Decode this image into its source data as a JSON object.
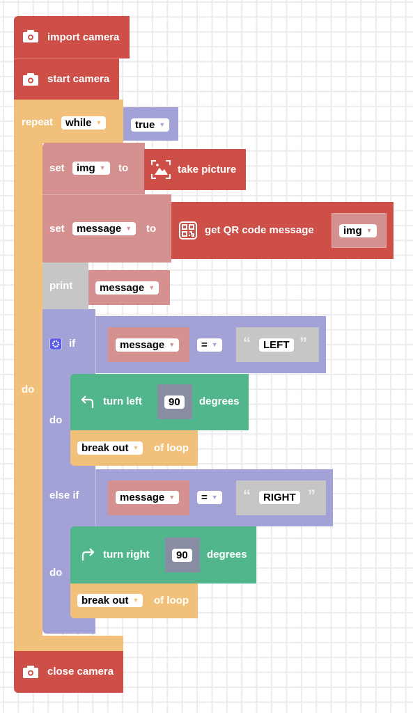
{
  "workspace": {
    "blocks": {
      "import_camera": {
        "label": "import camera",
        "icon": "camera-icon"
      },
      "start_camera": {
        "label": "start camera",
        "icon": "camera-icon"
      },
      "repeat": {
        "label": "repeat",
        "mode": "while",
        "do_label": "do",
        "condition": "true"
      },
      "set_img": {
        "set_label": "set",
        "variable": "img",
        "to_label": "to",
        "value_label": "take picture",
        "value_icon": "image-capture-icon"
      },
      "set_message": {
        "set_label": "set",
        "variable": "message",
        "to_label": "to",
        "value_label": "get QR code message",
        "value_icon": "qr-code-icon",
        "arg": "img"
      },
      "print": {
        "label": "print",
        "arg": "message"
      },
      "if_block": {
        "if_label": "if",
        "else_if_label": "else if",
        "do_label": "do",
        "branches": [
          {
            "variable": "message",
            "operator": "=",
            "text_value": "LEFT",
            "turn_label": "turn left",
            "degrees_value": "90",
            "degrees_label": "degrees",
            "turn_icon": "turn-left-icon",
            "break_value": "break out",
            "break_suffix": "of loop"
          },
          {
            "variable": "message",
            "operator": "=",
            "text_value": "RIGHT",
            "turn_label": "turn right",
            "degrees_value": "90",
            "degrees_label": "degrees",
            "turn_icon": "turn-right-icon",
            "break_value": "break out",
            "break_suffix": "of loop"
          }
        ]
      },
      "close_camera": {
        "label": "close camera",
        "icon": "camera-icon"
      }
    },
    "quote_open": "“",
    "quote_close": "”",
    "dropdown_arrow": "▼"
  },
  "colors": {
    "camera_red": "#cd4f47",
    "loop_orange": "#f1c17b",
    "logic_purple": "#a3a2d6",
    "variable_pink": "#d49190",
    "text_gray": "#c6c6c6",
    "motion_green": "#52b68c",
    "number_slate": "#888da4"
  }
}
